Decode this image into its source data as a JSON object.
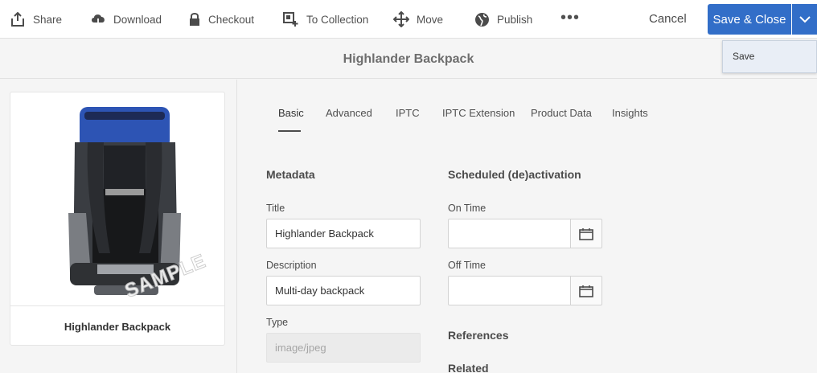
{
  "toolbar": {
    "share": "Share",
    "download": "Download",
    "checkout": "Checkout",
    "to_collection": "To Collection",
    "move": "Move",
    "publish": "Publish",
    "more": "•••",
    "cancel": "Cancel",
    "save_close": "Save & Close"
  },
  "save_menu": {
    "save": "Save"
  },
  "page_title": "Highlander Backpack",
  "asset_card": {
    "label": "Highlander Backpack",
    "watermark": "SAMPLE"
  },
  "tabs": [
    {
      "label": "Basic",
      "active": true
    },
    {
      "label": "Advanced"
    },
    {
      "label": "IPTC"
    },
    {
      "label": "IPTC Extension"
    },
    {
      "label": "Product Data"
    },
    {
      "label": "Insights"
    }
  ],
  "metadata": {
    "heading": "Metadata",
    "title_label": "Title",
    "title_value": "Highlander Backpack",
    "description_label": "Description",
    "description_value": "Multi-day backpack",
    "type_label": "Type",
    "type_value": "image/jpeg"
  },
  "scheduling": {
    "heading": "Scheduled (de)activation",
    "on_time_label": "On Time",
    "on_time_value": "",
    "off_time_label": "Off Time",
    "off_time_value": ""
  },
  "references_heading": "References",
  "related_heading": "Related",
  "colors": {
    "accent": "#326ec8",
    "menu_bg": "#e9eef6"
  },
  "icons": [
    "share-icon",
    "download-icon",
    "checkout-icon",
    "collection-icon",
    "move-icon",
    "publish-icon",
    "more-icon",
    "chevron-down-icon",
    "calendar-icon"
  ]
}
